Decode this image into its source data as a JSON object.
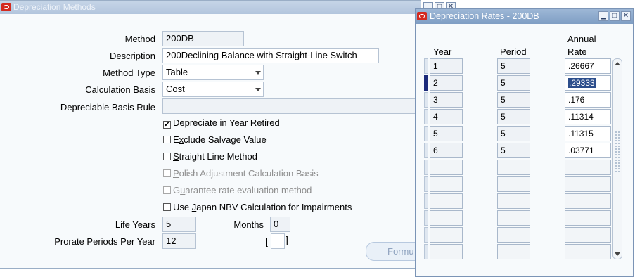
{
  "main_window": {
    "title": "Depreciation Methods",
    "labels": {
      "method": "Method",
      "description": "Description",
      "method_type": "Method Type",
      "calculation_basis": "Calculation Basis",
      "depreciable_basis_rule": "Depreciable Basis Rule",
      "life_years": "Life Years",
      "months": "Months",
      "prorate_periods": "Prorate Periods Per Year"
    },
    "values": {
      "method": "200DB",
      "description": "200Declining Balance with Straight-Line Switch",
      "method_type": "Table",
      "calculation_basis": "Cost",
      "depreciable_basis_rule": "",
      "life_years": "5",
      "months": "0",
      "prorate_periods": "12"
    },
    "checkboxes": [
      {
        "label_pre": "",
        "mnemonic": "D",
        "label_post": "epreciate in Year Retired",
        "checked": true,
        "enabled": true
      },
      {
        "label_pre": "E",
        "mnemonic": "x",
        "label_post": "clude Salvage Value",
        "checked": false,
        "enabled": true
      },
      {
        "label_pre": "",
        "mnemonic": "S",
        "label_post": "traight Line Method",
        "checked": false,
        "enabled": true
      },
      {
        "label_pre": "",
        "mnemonic": "P",
        "label_post": "olish Adjustment Calculation Basis",
        "checked": false,
        "enabled": false
      },
      {
        "label_pre": "G",
        "mnemonic": "u",
        "label_post": "arantee rate evaluation method",
        "checked": false,
        "enabled": false
      },
      {
        "label_pre": "Use ",
        "mnemonic": "J",
        "label_post": "apan NBV Calculation for Impairments",
        "checked": false,
        "enabled": true
      }
    ],
    "bracket_left": "[",
    "bracket_right": "]",
    "formula_button": "Formu"
  },
  "rates_window": {
    "title": "Depreciation Rates - 200DB",
    "headers": {
      "year": "Year",
      "period": "Period",
      "annual": "Annual",
      "rate": "Rate"
    },
    "rows": [
      {
        "year": "1",
        "period": "5",
        "rate": ".26667"
      },
      {
        "year": "2",
        "period": "5",
        "rate": ".29333"
      },
      {
        "year": "3",
        "period": "5",
        "rate": ".176"
      },
      {
        "year": "4",
        "period": "5",
        "rate": ".11314"
      },
      {
        "year": "5",
        "period": "5",
        "rate": ".11315"
      },
      {
        "year": "6",
        "period": "5",
        "rate": ".03771"
      }
    ],
    "empty_row_count": 6,
    "current_row": 2
  },
  "titlebar_buttons": {
    "minimize": "▁",
    "maximize": "□",
    "close": "✕"
  },
  "colors": {
    "titlebar": "#8aa8cc",
    "oracle_red": "#d42a1f",
    "selection": "#2c4e8c"
  }
}
